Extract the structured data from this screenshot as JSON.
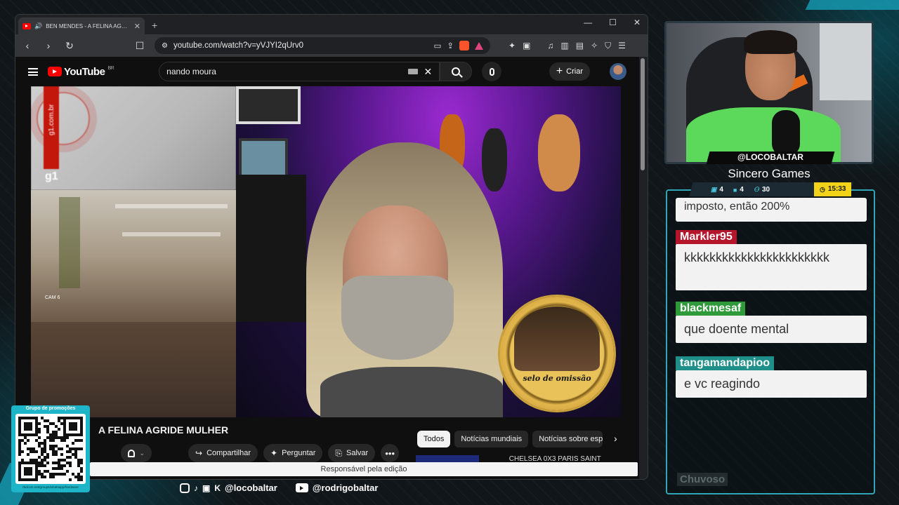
{
  "browser": {
    "tab_title": "BEN MENDES - A FELINA AGRIDE M",
    "tab_close": "✕",
    "new_tab": "+",
    "url": "youtube.com/watch?v=yVJYI2qUrv0",
    "window_controls": {
      "minimize": "—",
      "maximize": "☐",
      "close": "✕"
    },
    "nav": {
      "back": "‹",
      "forward": "›",
      "reload": "↻",
      "bookmark": "☐"
    }
  },
  "youtube": {
    "logo_text": "YouTube",
    "logo_region": "BR",
    "search_query": "nando moura",
    "create_label": "Criar",
    "video_title": "A FELINA AGRIDE MULHER",
    "actions": {
      "share": "Compartilhar",
      "ask": "Perguntar",
      "save": "Salvar",
      "more": "•••"
    },
    "chips": [
      "Todos",
      "Notícias mundiais",
      "Notícias sobre esp"
    ],
    "recommendation_preview": "CHELSEA 0X3 PARIS SAINT",
    "edit_banner": "Responsável pela edição",
    "seal_label": "selo de omissão",
    "g1_url": "g1.com.br",
    "g1_logo": "g1",
    "cctv_label": "CAM 6"
  },
  "stream": {
    "handle": "@LOCOBALTAR",
    "channel_name": "Sincero Games",
    "stats": {
      "chat": "4",
      "video": "4",
      "followers": "30",
      "time": "15:33"
    },
    "chat_first_partial": "imposto, então 200%",
    "messages": [
      {
        "user": "Markler95",
        "text": "kkkkkkkkkkkkkkkkkkkkkkk",
        "color": "#b5162c"
      },
      {
        "user": "blackmesaf",
        "text": "que doente mental",
        "color": "#2e9a3a"
      },
      {
        "user": "tangamandapioo",
        "text": "e vc reagindo",
        "color": "#1f8f8a"
      }
    ],
    "weather": "Chuvoso",
    "qr_title": "Grupo de promoções",
    "qr_url": "rbdcom.net/groups/whatsapp/hardware",
    "socials": {
      "handle1": "@locobaltar",
      "handle2": "@rodrigobaltar"
    }
  },
  "colors": {
    "accent": "#2fa6b8",
    "yt_red": "#ff0000",
    "clock_yellow": "#f3d21a"
  }
}
